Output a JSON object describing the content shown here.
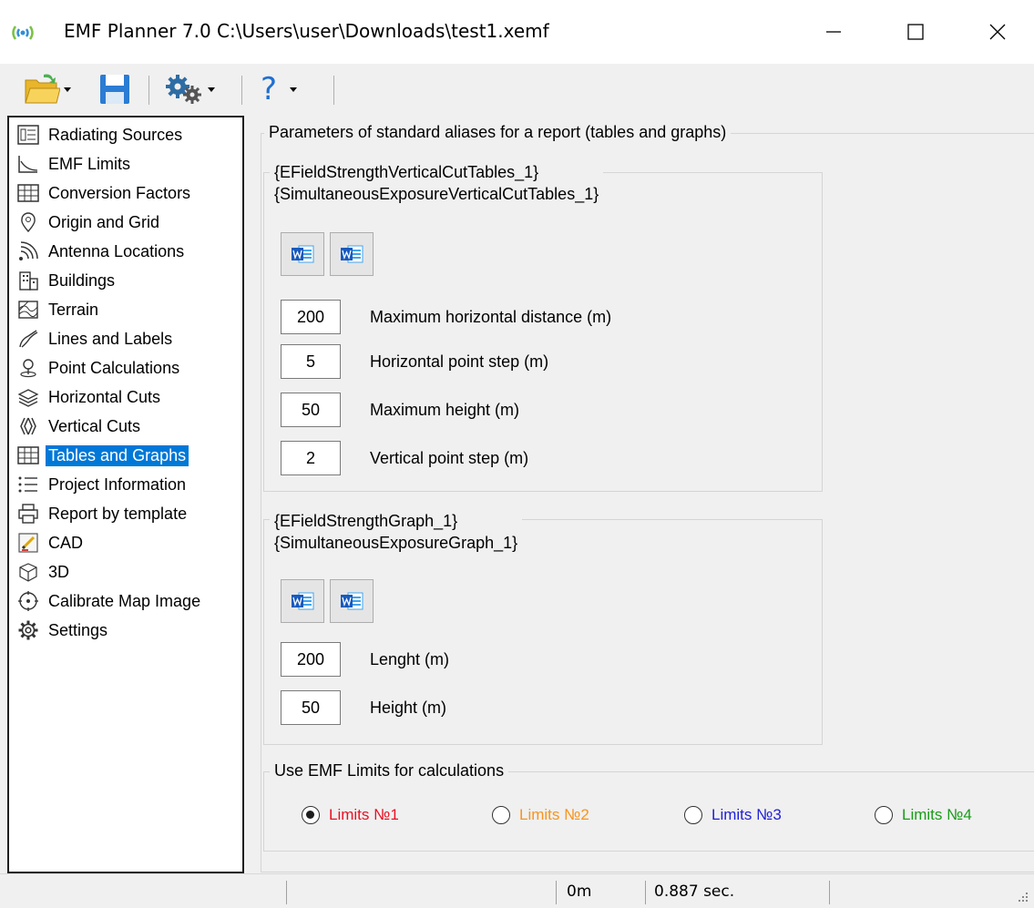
{
  "window": {
    "title": "EMF Planner 7.0 C:\\Users\\user\\Downloads\\test1.xemf"
  },
  "toolbar": {
    "help_label": "?"
  },
  "nav": {
    "items": [
      {
        "label": "Radiating Sources",
        "icon": "sources-icon"
      },
      {
        "label": "EMF Limits",
        "icon": "limits-icon"
      },
      {
        "label": "Conversion Factors",
        "icon": "table-icon"
      },
      {
        "label": "Origin and Grid",
        "icon": "location-pin-icon"
      },
      {
        "label": "Antenna Locations",
        "icon": "antenna-signal-icon"
      },
      {
        "label": "Buildings",
        "icon": "building-icon"
      },
      {
        "label": "Terrain",
        "icon": "terrain-icon"
      },
      {
        "label": "Lines and Labels",
        "icon": "lines-icon"
      },
      {
        "label": "Point Calculations",
        "icon": "point-icon"
      },
      {
        "label": "Horizontal Cuts",
        "icon": "layers-icon"
      },
      {
        "label": "Vertical Cuts",
        "icon": "vertical-cuts-icon"
      },
      {
        "label": "Tables and Graphs",
        "icon": "table-icon"
      },
      {
        "label": "Project Information",
        "icon": "list-icon"
      },
      {
        "label": "Report by template",
        "icon": "printer-icon"
      },
      {
        "label": "CAD",
        "icon": "cad-icon"
      },
      {
        "label": "3D",
        "icon": "cube-icon"
      },
      {
        "label": "Calibrate Map Image",
        "icon": "crosshair-icon"
      },
      {
        "label": "Settings",
        "icon": "gear-icon"
      }
    ],
    "selected": "Tables and Graphs"
  },
  "main": {
    "outer_group_title": "Parameters of standard aliases for a report (tables and graphs)",
    "cut_group": {
      "title_line1": "{EFieldStrengthVerticalCutTables_1}",
      "title_line2": "{SimultaneousExposureVerticalCutTables_1}",
      "fields": [
        {
          "value": "200",
          "label": "Maximum horizontal distance (m)"
        },
        {
          "value": "5",
          "label": "Horizontal point step (m)"
        },
        {
          "value": "50",
          "label": "Maximum height (m)"
        },
        {
          "value": "2",
          "label": "Vertical point step (m)"
        }
      ]
    },
    "graph_group": {
      "title_line1": "{EFieldStrengthGraph_1}",
      "title_line2": "{SimultaneousExposureGraph_1}",
      "fields": [
        {
          "value": "200",
          "label": "Lenght (m)"
        },
        {
          "value": "50",
          "label": "Height (m)"
        }
      ]
    },
    "limits_group": {
      "title": "Use EMF Limits for calculations",
      "options": [
        {
          "label": "Limits №1",
          "color": "#e81123",
          "checked": true
        },
        {
          "label": "Limits №2",
          "color": "#f7941d",
          "checked": false
        },
        {
          "label": "Limits №3",
          "color": "#1f1fd6",
          "checked": false
        },
        {
          "label": "Limits №4",
          "color": "#1a9c1a",
          "checked": false
        }
      ]
    }
  },
  "status": {
    "cell3": "0m",
    "cell4": "0.887 sec."
  }
}
